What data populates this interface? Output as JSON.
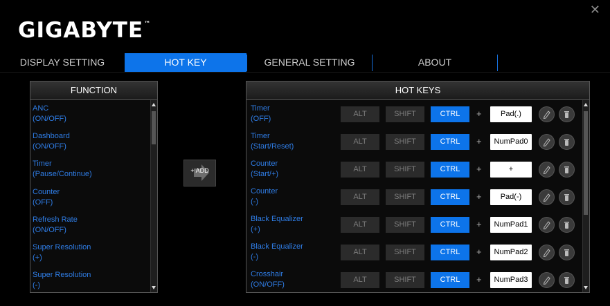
{
  "brand": {
    "logo": "GIGABYTE",
    "trademark": "™"
  },
  "window": {
    "close_symbol": "✕"
  },
  "tabs": [
    {
      "label": "DISPLAY SETTING",
      "active": false
    },
    {
      "label": "HOT KEY",
      "active": true
    },
    {
      "label": "GENERAL SETTING",
      "active": false
    },
    {
      "label": "ABOUT",
      "active": false
    }
  ],
  "function_panel": {
    "title": "FUNCTION",
    "items": [
      {
        "line1": "ANC",
        "line2": "(ON/OFF)"
      },
      {
        "line1": "Dashboard",
        "line2": "(ON/OFF)"
      },
      {
        "line1": "Timer",
        "line2": "(Pause/Continue)"
      },
      {
        "line1": "Counter",
        "line2": "(OFF)"
      },
      {
        "line1": "Refresh Rate",
        "line2": "(ON/OFF)"
      },
      {
        "line1": "Super Resolution",
        "line2": "(+)"
      },
      {
        "line1": "Super Resolution",
        "line2": "(-)"
      }
    ]
  },
  "add_button": {
    "label": "+ ADD"
  },
  "hotkeys_panel": {
    "title": "HOT KEYS",
    "modifier_labels": {
      "alt": "ALT",
      "shift": "SHIFT",
      "ctrl": "CTRL"
    },
    "plus": "+",
    "rows": [
      {
        "line1": "Timer",
        "line2": "(OFF)",
        "alt": false,
        "shift": false,
        "ctrl": true,
        "key": "Pad(.)"
      },
      {
        "line1": "Timer",
        "line2": "(Start/Reset)",
        "alt": false,
        "shift": false,
        "ctrl": true,
        "key": "NumPad0"
      },
      {
        "line1": "Counter",
        "line2": "(Start/+)",
        "alt": false,
        "shift": false,
        "ctrl": true,
        "key": "+"
      },
      {
        "line1": "Counter",
        "line2": "(-)",
        "alt": false,
        "shift": false,
        "ctrl": true,
        "key": "Pad(-)"
      },
      {
        "line1": "Black Equalizer",
        "line2": "(+)",
        "alt": false,
        "shift": false,
        "ctrl": true,
        "key": "NumPad1"
      },
      {
        "line1": "Black Equalizer",
        "line2": "(-)",
        "alt": false,
        "shift": false,
        "ctrl": true,
        "key": "NumPad2"
      },
      {
        "line1": "Crosshair",
        "line2": "(ON/OFF)",
        "alt": false,
        "shift": false,
        "ctrl": true,
        "key": "NumPad3"
      }
    ]
  },
  "colors": {
    "accent": "#0d74ea",
    "link_text": "#2f7de6"
  }
}
